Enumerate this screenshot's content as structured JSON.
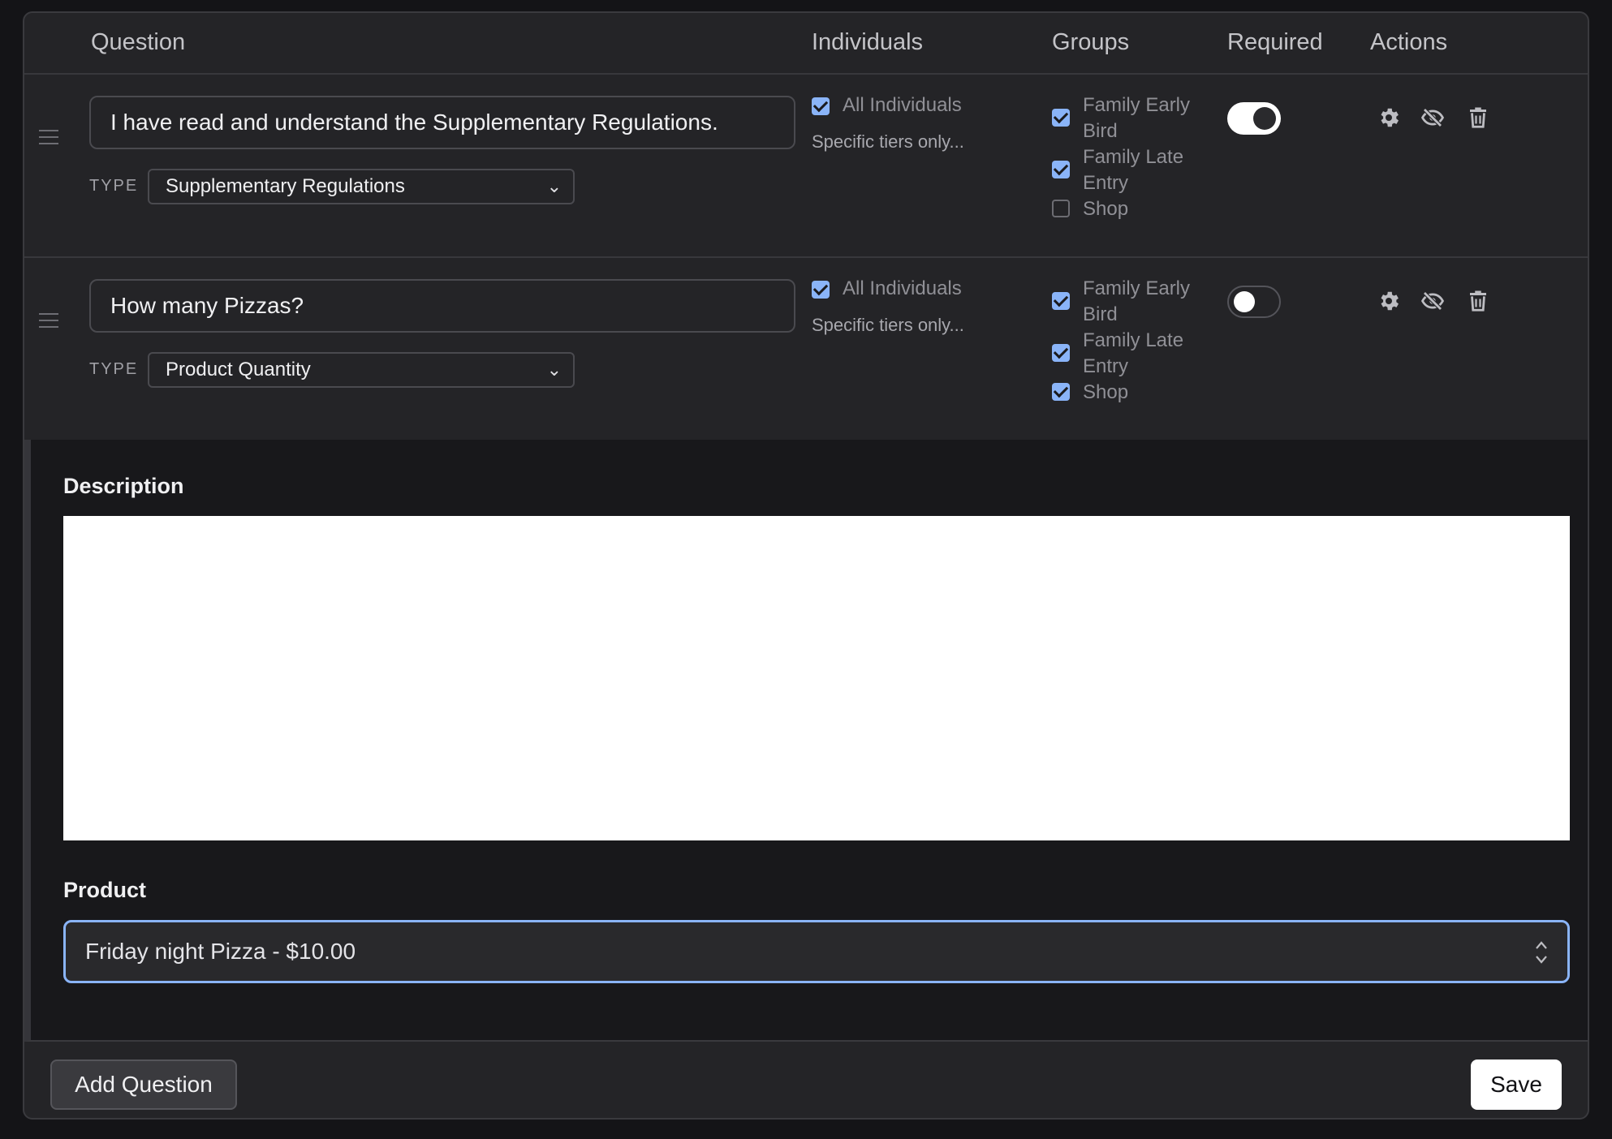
{
  "columns": {
    "question": "Question",
    "individuals": "Individuals",
    "groups": "Groups",
    "required": "Required",
    "actions": "Actions"
  },
  "type_label": "TYPE",
  "questions": [
    {
      "text": "I have read and understand the Supplementary Regulations.",
      "type": "Supplementary Regulations",
      "individuals": {
        "all_label": "All Individuals",
        "all_checked": true,
        "specific_link": "Specific tiers only..."
      },
      "groups": [
        {
          "line1": "Family Early",
          "line2": "Bird",
          "checked": true
        },
        {
          "line1": "Family Late",
          "line2": "Entry",
          "checked": true
        },
        {
          "line1": "Shop",
          "checked": false
        }
      ],
      "required": true
    },
    {
      "text": "How many Pizzas?",
      "type": "Product Quantity",
      "individuals": {
        "all_label": "All Individuals",
        "all_checked": true,
        "specific_link": "Specific tiers only..."
      },
      "groups": [
        {
          "line1": "Family Early",
          "line2": "Bird",
          "checked": true
        },
        {
          "line1": "Family Late",
          "line2": "Entry",
          "checked": true
        },
        {
          "line1": "Shop",
          "checked": true
        }
      ],
      "required": false
    }
  ],
  "details": {
    "description_label": "Description",
    "product_label": "Product",
    "product_value": "Friday night Pizza - $10.00"
  },
  "footer": {
    "add_label": "Add Question",
    "save_label": "Save"
  },
  "icons": {
    "drag": "drag-handle-icon",
    "settings": "gear-icon",
    "visibility": "eye-off-icon",
    "delete": "trash-icon"
  },
  "colors": {
    "accent": "#8ab4f8",
    "panel": "#242427",
    "background": "#141417"
  }
}
